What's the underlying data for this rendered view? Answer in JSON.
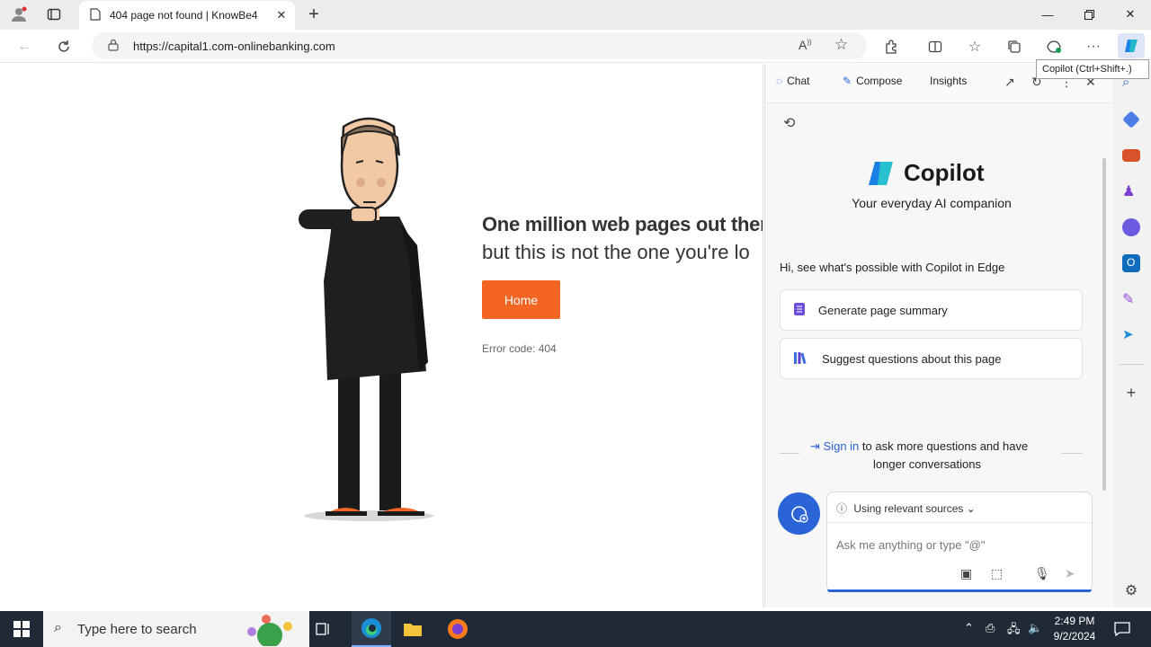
{
  "browser": {
    "tab_title": "404 page not found | KnowBe4",
    "url": "https://capital1.com-onlinebanking.com",
    "tooltip": "Copilot (Ctrl+Shift+.)"
  },
  "page": {
    "headline_line1": "One million web pages out ther",
    "headline_line2": "but this is not the one you're lo",
    "home_button": "Home",
    "error_code": "Error code: 404"
  },
  "copilot": {
    "tabs": [
      "Chat",
      "Compose",
      "Insights"
    ],
    "brand": "Copilot",
    "tagline": "Your everyday AI companion",
    "intro": "Hi, see what's possible with Copilot in Edge",
    "suggestions": [
      "Generate page summary",
      "Suggest questions about this page"
    ],
    "signin_link": "Sign in",
    "signin_text_1": "to ask more questions and have",
    "signin_text_2": "longer conversations",
    "sources_label": "Using relevant sources",
    "input_placeholder": "Ask me anything or type \"@\""
  },
  "taskbar": {
    "search_placeholder": "Type here to search",
    "time": "2:49 PM",
    "date": "9/2/2024"
  },
  "colors": {
    "accent_orange": "#f26522",
    "copilot_blue": "#2b64d6",
    "taskbar": "#1f2a36"
  }
}
